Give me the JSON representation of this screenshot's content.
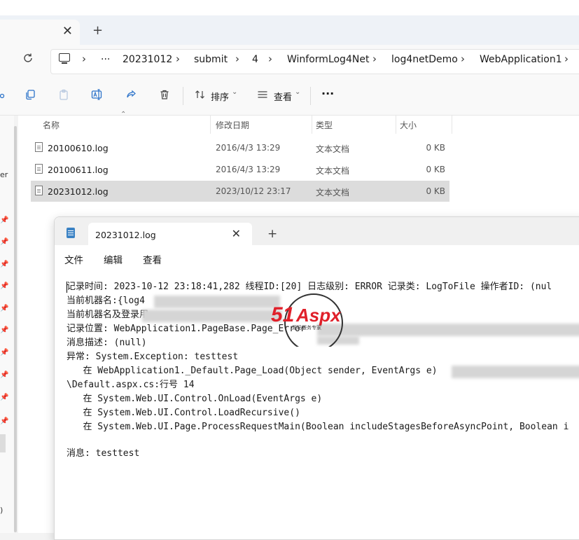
{
  "explorer": {
    "tab_close": "✕",
    "new_tab": "+",
    "refresh_icon": "refresh-icon",
    "more": "···",
    "breadcrumbs": [
      "20231012",
      "submit",
      "4",
      "WinformLog4Net",
      "log4netDemo",
      "WebApplication1"
    ],
    "separator": "›",
    "commands": {
      "sort": "排序",
      "view": "查看",
      "more": "···"
    },
    "columns": {
      "name": "名称",
      "date": "修改日期",
      "type": "类型",
      "size": "大小"
    },
    "files": [
      {
        "name": "20100610.log",
        "date": "2016/4/3 13:29",
        "type": "文本文档",
        "size": "0 KB"
      },
      {
        "name": "20100611.log",
        "date": "2016/4/3 13:29",
        "type": "文本文档",
        "size": "0 KB"
      },
      {
        "name": "20231012.log",
        "date": "2023/10/12 23:17",
        "type": "文本文档",
        "size": "0 KB"
      }
    ],
    "nav_fragment": "er",
    "nav_fragment2": ")"
  },
  "notepad": {
    "tab_title": "20231012.log",
    "tab_close": "✕",
    "new_tab": "+",
    "menu": [
      "文件",
      "编辑",
      "查看"
    ],
    "lines": [
      "记录时间: 2023-10-12 23:18:41,282 线程ID:[20] 日志级别: ERROR 记录类: LogToFile 操作者ID: (nul",
      "当前机器名:{log4",
      "当前机器名及登录用",
      "记录位置: WebApplication1.PageBase.Page_Error",
      "消息描述: (null)",
      "异常: System.Exception: testtest",
      "   在 WebApplication1._Default.Page_Load(Object sender, EventArgs e)",
      "\\Default.aspx.cs:行号 14",
      "   在 System.Web.UI.Control.OnLoad(EventArgs e)",
      "   在 System.Web.UI.Control.LoadRecursive()",
      "   在 System.Web.UI.Page.ProcessRequestMain(Boolean includeStagesBeforeAsyncPoint, Boolean i",
      "",
      "消息: testtest"
    ]
  },
  "watermark": {
    "brand": "51Aspx",
    "brand_num": "51",
    "brand_txt": "Aspx",
    "slogan": "源码服务专家"
  },
  "colors": {
    "accent": "#2b72c9",
    "selected_row": "#dcdcdc",
    "logo_red": "#e0202a",
    "logo_green": "#3a9a2a"
  }
}
